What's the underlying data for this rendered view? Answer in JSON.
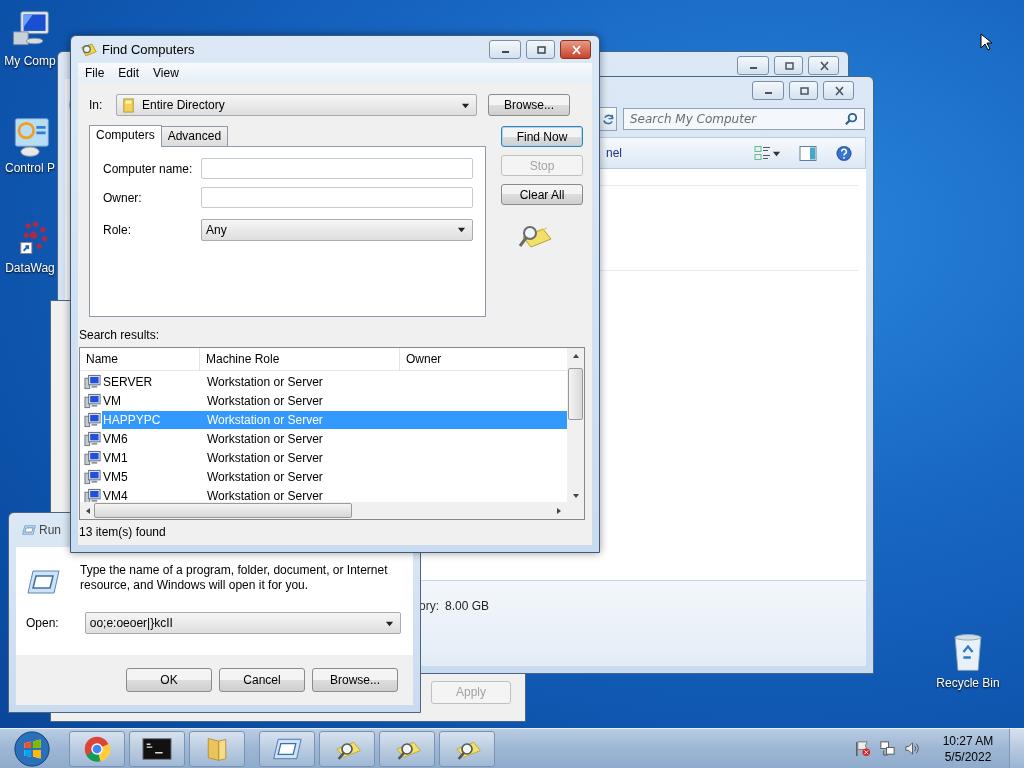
{
  "desktop_icons": [
    {
      "kind": "computer",
      "label": "My Comp"
    },
    {
      "kind": "control",
      "label": "Control P"
    },
    {
      "kind": "app",
      "label": "DataWag"
    },
    {
      "kind": "recycle",
      "label": "Recycle Bin"
    }
  ],
  "settings_window": {
    "buttons": [
      {
        "label": "Apply",
        "disabled": true
      }
    ]
  },
  "explorer_window": {
    "search": {
      "placeholder": "Search My Computer"
    },
    "toolbar_text": "nel",
    "details": {
      "label": "ory:",
      "value": "8.00 GB"
    }
  },
  "find_window": {
    "title": "Find Computers",
    "menu": [
      "File",
      "Edit",
      "View"
    ],
    "in_label": "In:",
    "in_value": "Entire Directory",
    "browse": "Browse...",
    "tabs": [
      {
        "label": "Computers",
        "selected": true
      },
      {
        "label": "Advanced",
        "selected": false
      }
    ],
    "fields": [
      {
        "kind": "text",
        "label": "Computer name:"
      },
      {
        "kind": "text",
        "label": "Owner:"
      },
      {
        "kind": "select",
        "label": "Role:",
        "value": "Any"
      }
    ],
    "buttons": [
      {
        "label": "Find Now",
        "default": true,
        "disabled": false
      },
      {
        "label": "Stop",
        "default": false,
        "disabled": true
      },
      {
        "label": "Clear All",
        "default": false,
        "disabled": false
      }
    ],
    "results_label": "Search results:",
    "columns": [
      "Name",
      "Machine Role",
      "Owner"
    ],
    "rows": [
      {
        "name": "SERVER",
        "role": "Workstation or Server",
        "selected": false
      },
      {
        "name": "VM",
        "role": "Workstation or Server",
        "selected": false
      },
      {
        "name": "HAPPYPC",
        "role": "Workstation or Server",
        "selected": true
      },
      {
        "name": "VM6",
        "role": "Workstation or Server",
        "selected": false
      },
      {
        "name": "VM1",
        "role": "Workstation or Server",
        "selected": false
      },
      {
        "name": "VM5",
        "role": "Workstation or Server",
        "selected": false
      },
      {
        "name": "VM4",
        "role": "Workstation or Server",
        "selected": false
      }
    ],
    "status": "13 item(s) found"
  },
  "run_dialog": {
    "title": "Run",
    "message": "Type the name of a program, folder, document, or Internet resource, and Windows will open it for you.",
    "open_label": "Open:",
    "open_value": "oo;e:oeoer|}kcII",
    "buttons": [
      "OK",
      "Cancel",
      "Browse..."
    ]
  },
  "taskbar": {
    "items": [
      {
        "kind": "chrome"
      },
      {
        "kind": "console"
      },
      {
        "kind": "folder"
      },
      {
        "kind": "run"
      },
      {
        "kind": "find"
      },
      {
        "kind": "find"
      },
      {
        "kind": "find"
      }
    ],
    "clock": {
      "time": "10:27 AM",
      "date": "5/5/2022"
    }
  }
}
